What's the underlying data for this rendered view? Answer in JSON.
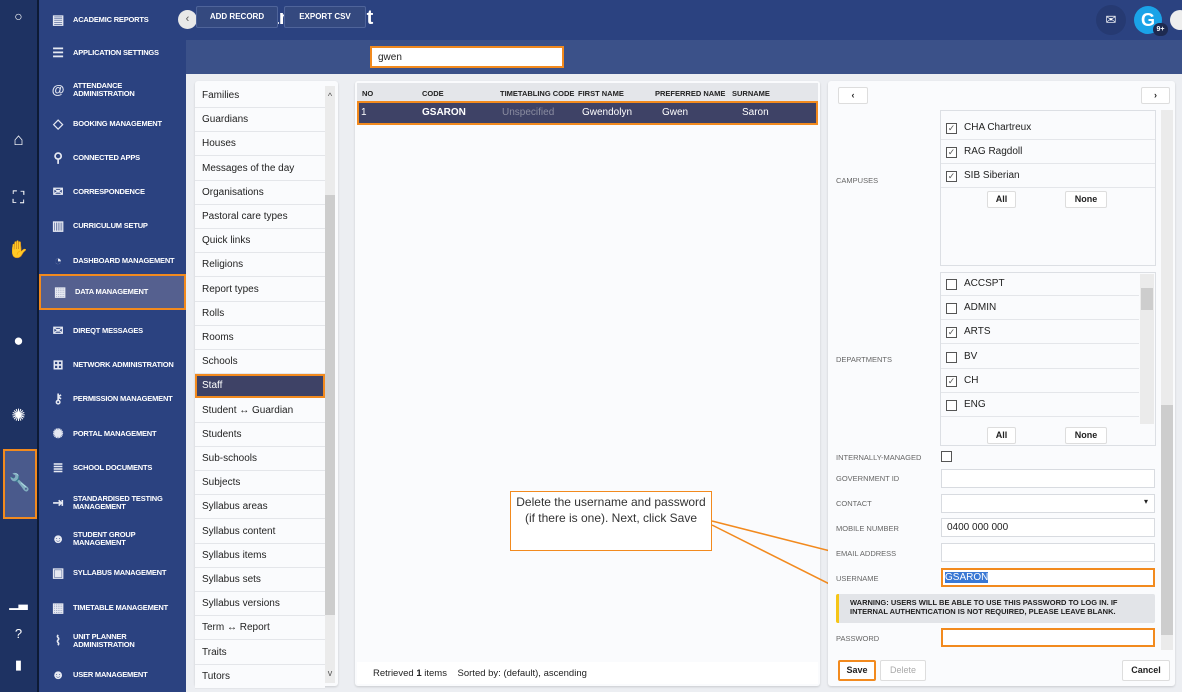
{
  "rail": {
    "icons": [
      "search-icon",
      "home-icon",
      "presentation-icon",
      "hand-icon",
      "user-icon",
      "portal-icon",
      "wrench-icon",
      "chart-icon",
      "help-icon",
      "logout-icon"
    ]
  },
  "nav": {
    "items": [
      {
        "label": "ACADEMIC REPORTS",
        "icon": "report-icon"
      },
      {
        "label": "APPLICATION SETTINGS",
        "icon": "settings-icon"
      },
      {
        "label": "ATTENDANCE ADMINISTRATION",
        "icon": "attendance-icon"
      },
      {
        "label": "BOOKING MANAGEMENT",
        "icon": "ticket-icon"
      },
      {
        "label": "CONNECTED APPS",
        "icon": "connected-icon"
      },
      {
        "label": "CORRESPONDENCE",
        "icon": "correspondence-icon"
      },
      {
        "label": "CURRICULUM SETUP",
        "icon": "curriculum-icon"
      },
      {
        "label": "DASHBOARD MANAGEMENT",
        "icon": "dashboard-icon"
      },
      {
        "label": "DATA MANAGEMENT",
        "icon": "data-icon",
        "selected": true
      },
      {
        "label": "DIREQT MESSAGES",
        "icon": "message-icon"
      },
      {
        "label": "NETWORK ADMINISTRATION",
        "icon": "network-icon"
      },
      {
        "label": "PERMISSION MANAGEMENT",
        "icon": "key-icon"
      },
      {
        "label": "PORTAL MANAGEMENT",
        "icon": "portal-icon"
      },
      {
        "label": "SCHOOL DOCUMENTS",
        "icon": "document-icon"
      },
      {
        "label": "STANDARDISED TESTING MANAGEMENT",
        "icon": "testing-icon"
      },
      {
        "label": "STUDENT GROUP MANAGEMENT",
        "icon": "group-icon"
      },
      {
        "label": "SYLLABUS MANAGEMENT",
        "icon": "syllabus-icon"
      },
      {
        "label": "TIMETABLE MANAGEMENT",
        "icon": "timetable-icon"
      },
      {
        "label": "UNIT PLANNER ADMINISTRATION",
        "icon": "planner-icon"
      },
      {
        "label": "USER MANAGEMENT",
        "icon": "user-settings-icon"
      }
    ]
  },
  "header": {
    "title": "Data management",
    "avatar_letter": "G",
    "badge": "9+"
  },
  "toolbar": {
    "add_record": "ADD RECORD",
    "export_csv": "EXPORT CSV",
    "search_value": "gwen"
  },
  "entities": [
    "Families",
    "Guardians",
    "Houses",
    "Messages of the day",
    "Organisations",
    "Pastoral care types",
    "Quick links",
    "Religions",
    "Report types",
    "Rolls",
    "Rooms",
    "Schools",
    "Staff",
    "Student ↔ Guardian",
    "Students",
    "Sub-schools",
    "Subjects",
    "Syllabus areas",
    "Syllabus content",
    "Syllabus items",
    "Syllabus sets",
    "Syllabus versions",
    "Term ↔ Report",
    "Traits",
    "Tutors"
  ],
  "selected_entity": "Staff",
  "table": {
    "columns": [
      "NO",
      "CODE",
      "TIMETABLING CODE",
      "FIRST NAME",
      "PREFERRED NAME",
      "SURNAME"
    ],
    "rows": [
      {
        "no": "1",
        "code": "GSARON",
        "timetabling_code": "Unspecified",
        "first_name": "Gwendolyn",
        "preferred_name": "Gwen",
        "surname": "Saron"
      }
    ],
    "footer_retrieved_prefix": "Retrieved ",
    "footer_count": "1",
    "footer_retrieved_suffix": " items",
    "footer_sort": "Sorted by: (default), ascending"
  },
  "form": {
    "campuses_label": "CAMPUSES",
    "campuses": [
      {
        "label": "CHA Chartreux",
        "checked": true
      },
      {
        "label": "RAG Ragdoll",
        "checked": true
      },
      {
        "label": "SIB Siberian",
        "checked": true
      }
    ],
    "departments_label": "DEPARTMENTS",
    "departments": [
      {
        "label": "ACCSPT",
        "checked": false
      },
      {
        "label": "ADMIN",
        "checked": false
      },
      {
        "label": "ARTS",
        "checked": true
      },
      {
        "label": "BV",
        "checked": false
      },
      {
        "label": "CH",
        "checked": true
      },
      {
        "label": "ENG",
        "checked": false
      }
    ],
    "all_label": "All",
    "none_label": "None",
    "internally_managed_label": "INTERNALLY-MANAGED",
    "government_id_label": "GOVERNMENT ID",
    "government_id": "",
    "contact_label": "CONTACT",
    "contact": "",
    "mobile_label": "MOBILE NUMBER",
    "mobile": "0400 000 000",
    "email_label": "EMAIL ADDRESS",
    "email": "",
    "username_label": "USERNAME",
    "username": "GSARON",
    "warning": "WARNING: USERS WILL BE ABLE TO USE THIS PASSWORD TO LOG IN. IF INTERNAL AUTHENTICATION IS NOT REQUIRED, PLEASE LEAVE BLANK.",
    "password_label": "PASSWORD",
    "password": "",
    "save": "Save",
    "delete": "Delete",
    "cancel": "Cancel"
  },
  "callout": {
    "text": "Delete the username and password (if there is one). Next, click Save"
  },
  "colors": {
    "accent": "#f28a1e",
    "nav_bg": "#2b4280",
    "selected_row": "#3e4266",
    "warning_bar": "#f5c518"
  }
}
